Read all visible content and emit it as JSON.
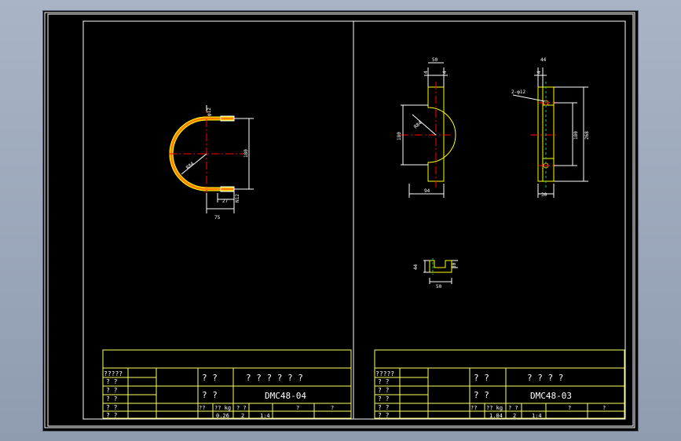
{
  "drawing": {
    "left_sheet": {
      "part_no": "DMC48-04",
      "title_row_a": "? ?",
      "title_row_b": "? ? ? ? ? ?",
      "title_row_c": "? ?",
      "header_label": "?????",
      "rows_left": [
        "? ?",
        "? ?",
        "? ?",
        "? ?",
        "? ?"
      ],
      "mass_header": "?? ?? kg ? ? ? ?",
      "mass_label_1": "??",
      "mass_label_2": "?? kg",
      "mass_label_3": "? ?",
      "mass_label_4": "?",
      "mass_label_5": "?",
      "mass_value": "0.26",
      "qty_value": "2",
      "scale_value": "1:4",
      "dims": {
        "phi12": "φ12",
        "r84": "R84",
        "d180": "180",
        "d75": "75",
        "d27": "27",
        "d12": "N12"
      }
    },
    "right_sheet": {
      "part_no": "DMC48-03",
      "title_row_a": "? ?",
      "title_row_b": "? ? ? ?",
      "title_row_c": "? ?",
      "header_label": "?????",
      "rows_left": [
        "? ?",
        "? ?",
        "? ?",
        "? ?",
        "? ?"
      ],
      "mass_label_1": "??",
      "mass_label_2": "?? kg",
      "mass_label_3": "? ?",
      "mass_label_4": "?",
      "mass_label_5": "?",
      "mass_value": "1.04",
      "qty_value": "2",
      "scale_value": "1:4",
      "dims": {
        "top_50": "50",
        "top_4a": "4",
        "top_4b": "4",
        "r84": "R84",
        "left_180": "180",
        "bottom_94": "94",
        "side_44": "44",
        "side_4": "4",
        "hole": "2-φ12",
        "side_180": "180",
        "side_268": "268",
        "side_30": "30",
        "small_44": "44",
        "small_50": "50",
        "small_30": "30"
      }
    }
  },
  "colors": {
    "frame": "#ffffff",
    "title_block": "#ffff66",
    "part": "#ffff00",
    "center": "#ff0000",
    "hatch": "#ff7f00"
  }
}
